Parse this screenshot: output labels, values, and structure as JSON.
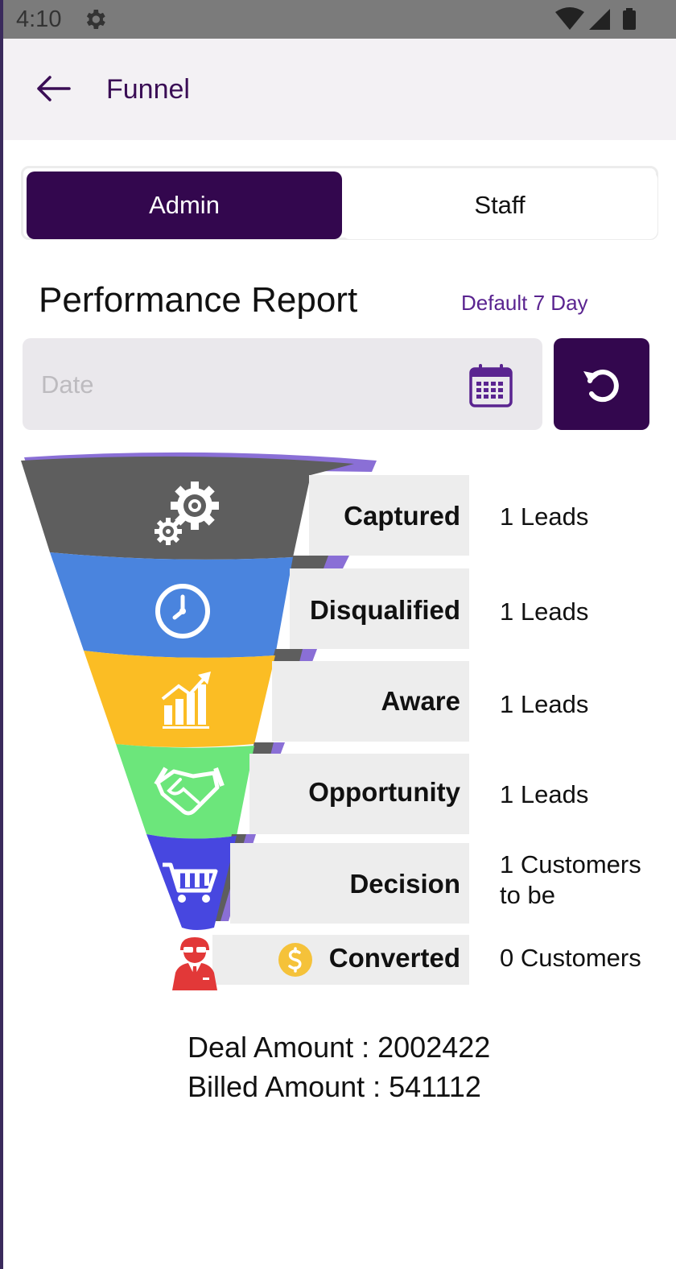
{
  "status_bar": {
    "time": "4:10"
  },
  "app_bar": {
    "title": "Funnel"
  },
  "segmented": {
    "options": [
      "Admin",
      "Staff"
    ],
    "selected": "Admin"
  },
  "report": {
    "title": "Performance Report",
    "default_range": "Default 7 Day"
  },
  "date_input": {
    "placeholder": "Date",
    "value": ""
  },
  "funnel": {
    "stages": [
      {
        "label": "Captured",
        "value": "1 Leads",
        "color": "#5e5e5e",
        "icon": "gears-icon"
      },
      {
        "label": "Disqualified",
        "value": "1 Leads",
        "color": "#4a84de",
        "icon": "clock-icon"
      },
      {
        "label": "Aware",
        "value": "1 Leads",
        "color": "#fbbd24",
        "icon": "growth-chart-icon"
      },
      {
        "label": "Opportunity",
        "value": "1 Leads",
        "color": "#6ce67b",
        "icon": "handshake-icon"
      },
      {
        "label": "Decision",
        "value_line1": "1 Customers",
        "value_line2": "to be",
        "color": "#4747e0",
        "icon": "cart-icon"
      },
      {
        "label": "Converted",
        "value": "0 Customers",
        "color": "#e23838",
        "icon": "businessman-icon"
      }
    ],
    "accent": "#8a6fd6"
  },
  "amounts": {
    "deal": "Deal Amount : 2002422",
    "billed": "Billed Amount : 541112"
  }
}
